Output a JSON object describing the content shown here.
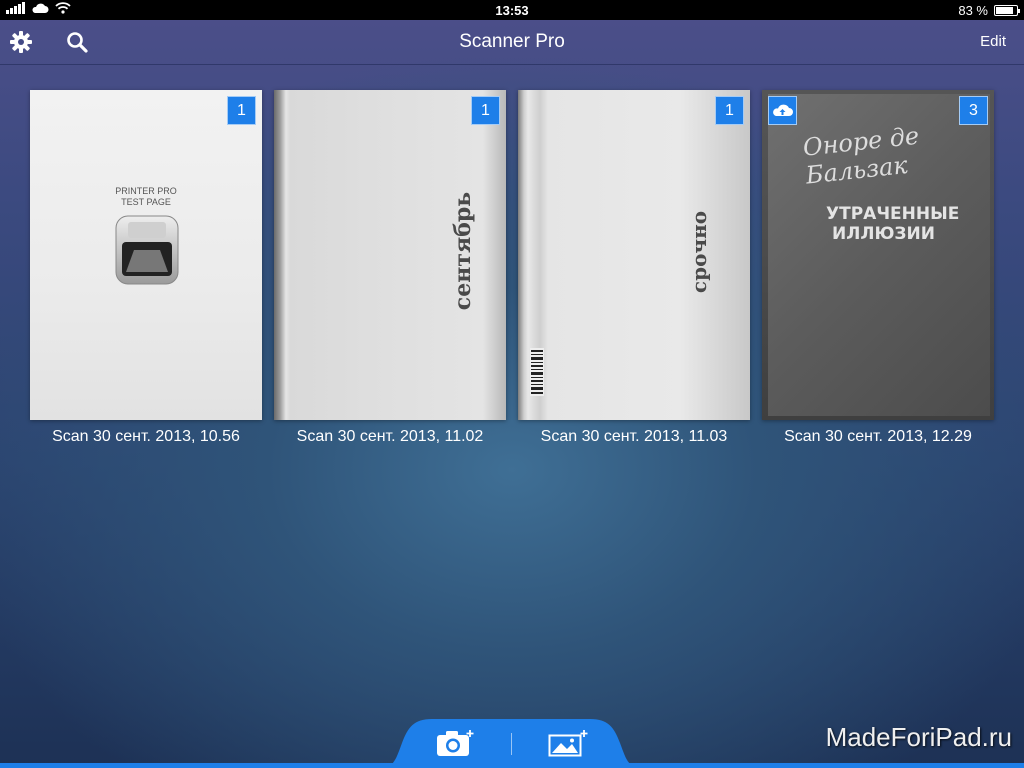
{
  "status_bar": {
    "time": "13:53",
    "battery_text": "83 %",
    "battery_level": 0.83,
    "icons": [
      "signal-bars-icon",
      "icloud-icon",
      "wifi-icon",
      "battery-icon"
    ]
  },
  "nav": {
    "title": "Scanner Pro",
    "edit_label": "Edit",
    "left_icons": [
      "gear-icon",
      "search-icon"
    ]
  },
  "documents": [
    {
      "label": "Scan 30 сент. 2013, 10.56",
      "page_count": "1",
      "thumb_text": [
        "PRINTER PRO",
        "TEST PAGE"
      ],
      "cloud": false
    },
    {
      "label": "Scan 30 сент. 2013, 11.02",
      "page_count": "1",
      "thumb_text": "сентябрь",
      "cloud": false
    },
    {
      "label": "Scan 30 сент. 2013, 11.03",
      "page_count": "1",
      "thumb_text": "срочно",
      "cloud": false
    },
    {
      "label": "Scan 30 сент. 2013, 12.29",
      "page_count": "3",
      "thumb_text": [
        "Оноре де Бальзак",
        "УТРАЧЕННЫЕ",
        "ИЛЛЮЗИИ"
      ],
      "cloud": true
    }
  ],
  "toolbar": {
    "icons": [
      "camera-add-icon",
      "photo-add-icon"
    ],
    "accent_color": "#1e7fe9"
  },
  "watermark": "MadeForiPad.ru"
}
